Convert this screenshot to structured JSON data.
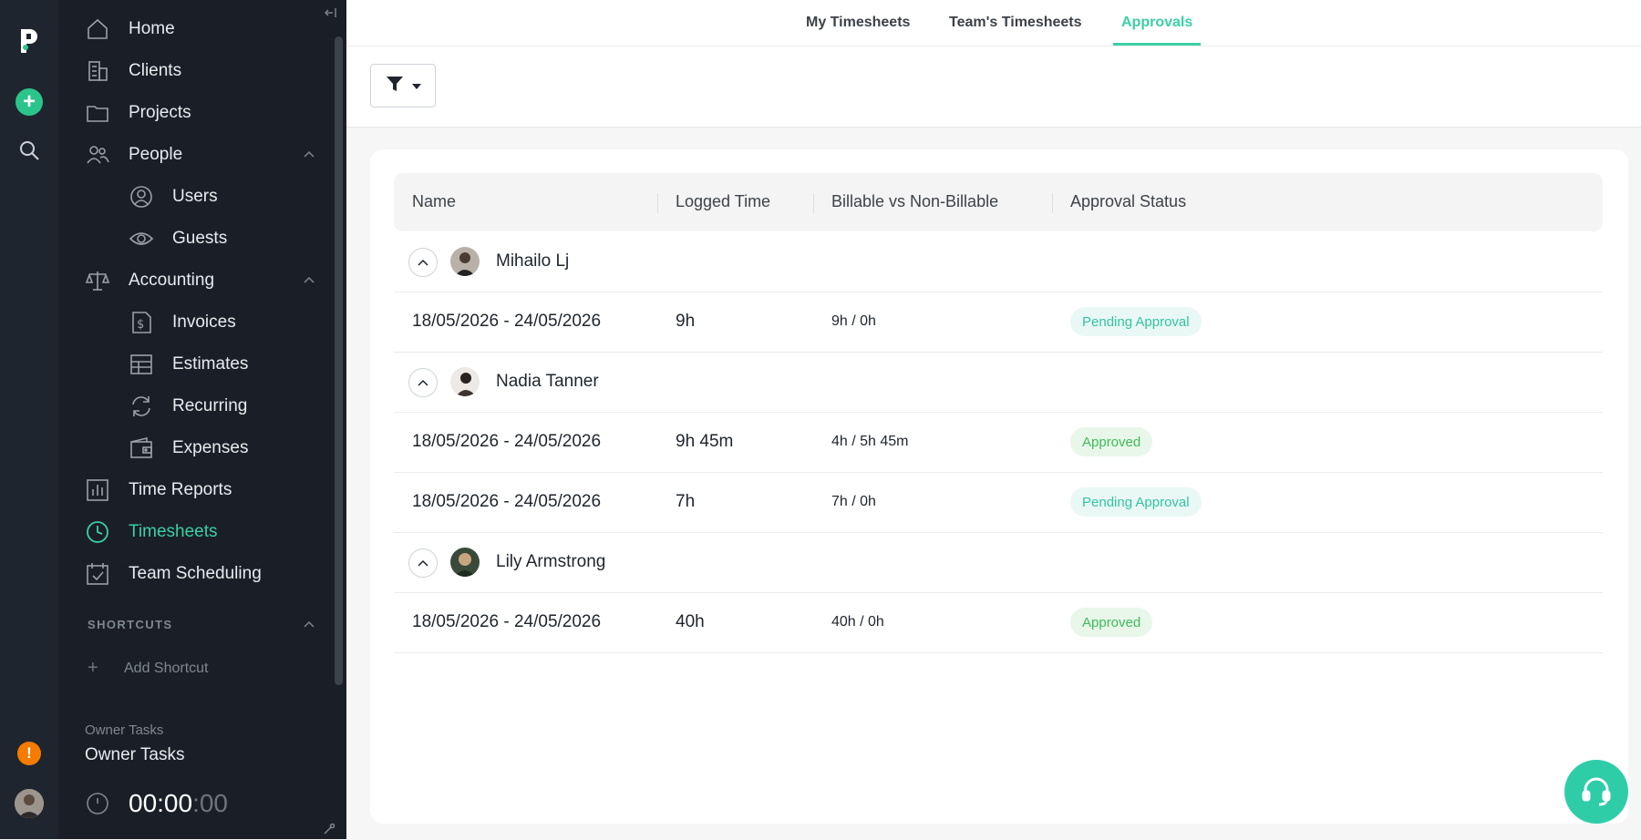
{
  "rail": {
    "logo_icon": "papershift-logo-icon",
    "add_icon": "plus-icon",
    "search_icon": "search-icon",
    "warning_icon": "warning-icon",
    "avatar_icon": "user-avatar"
  },
  "sidebar": {
    "items": [
      {
        "label": "Home",
        "icon": "home-icon"
      },
      {
        "label": "Clients",
        "icon": "building-icon"
      },
      {
        "label": "Projects",
        "icon": "folder-icon"
      },
      {
        "label": "People",
        "icon": "people-icon"
      },
      {
        "label": "Users",
        "icon": "user-circle-icon"
      },
      {
        "label": "Guests",
        "icon": "eye-icon"
      },
      {
        "label": "Accounting",
        "icon": "scale-icon"
      },
      {
        "label": "Invoices",
        "icon": "invoice-icon"
      },
      {
        "label": "Estimates",
        "icon": "table-icon"
      },
      {
        "label": "Recurring",
        "icon": "recurring-icon"
      },
      {
        "label": "Expenses",
        "icon": "wallet-icon"
      },
      {
        "label": "Time Reports",
        "icon": "bar-chart-icon"
      },
      {
        "label": "Timesheets",
        "icon": "clock-icon"
      },
      {
        "label": "Team Scheduling",
        "icon": "calendar-check-icon"
      }
    ],
    "active_item": "Timesheets",
    "shortcuts_title": "SHORTCUTS",
    "add_shortcut": "Add Shortcut",
    "owner_tasks_small": "Owner Tasks",
    "owner_tasks_big": "Owner Tasks",
    "timer_main": "00:00",
    "timer_seconds": ":00"
  },
  "tabs": [
    {
      "label": "My Timesheets",
      "active": false
    },
    {
      "label": "Team's Timesheets",
      "active": false
    },
    {
      "label": "Approvals",
      "active": true
    }
  ],
  "filter": {
    "icon": "filter-icon",
    "caret_icon": "caret-down-icon"
  },
  "table": {
    "headers": [
      "Name",
      "Logged Time",
      "Billable vs Non-Billable",
      "Approval Status"
    ],
    "groups": [
      {
        "name": "Mihailo Lj",
        "rows": [
          {
            "date": "18/05/2026 - 24/05/2026",
            "logged": "9h",
            "billable": "9h / 0h",
            "status": "Pending Approval"
          }
        ]
      },
      {
        "name": "Nadia Tanner",
        "rows": [
          {
            "date": "18/05/2026 - 24/05/2026",
            "logged": "9h 45m",
            "billable": "4h / 5h 45m",
            "status": "Approved"
          },
          {
            "date": "18/05/2026 - 24/05/2026",
            "logged": "7h",
            "billable": "7h / 0h",
            "status": "Pending Approval"
          }
        ]
      },
      {
        "name": "Lily Armstrong",
        "rows": [
          {
            "date": "18/05/2026 - 24/05/2026",
            "logged": "40h",
            "billable": "40h / 0h",
            "status": "Approved"
          }
        ]
      }
    ]
  },
  "colors": {
    "accent": "#3ccfa6",
    "sidebar_bg": "#1a1f27",
    "pending_text": "#34c3a2",
    "approved_text": "#40ba5a"
  },
  "help_icon": "headset-icon"
}
